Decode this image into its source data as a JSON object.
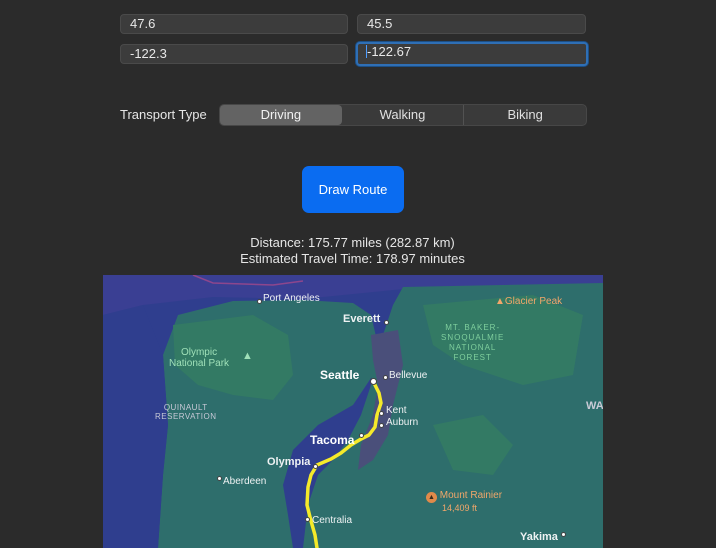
{
  "coordinates": {
    "lat1": "47.6",
    "lat2": "45.5",
    "lon1": "-122.3",
    "lon2": "-122.67"
  },
  "transport": {
    "label": "Transport Type",
    "options": [
      "Driving",
      "Walking",
      "Biking"
    ],
    "selected": "Driving"
  },
  "draw_button": "Draw Route",
  "result": {
    "distance": "Distance: 175.77 miles (282.87 km)",
    "travel_time": "Estimated Travel Time: 178.97 minutes"
  },
  "map": {
    "cities": {
      "port_angeles": "Port Angeles",
      "everett": "Everett",
      "seattle": "Seattle",
      "bellevue": "Bellevue",
      "kent": "Kent",
      "auburn": "Auburn",
      "tacoma": "Tacoma",
      "olympia": "Olympia",
      "aberdeen": "Aberdeen",
      "centralia": "Centralia",
      "yakima": "Yakima",
      "wa": "WA"
    },
    "parks": {
      "olympic_line1": "Olympic",
      "olympic_line2": "National Park",
      "forest_line1": "MT. BAKER-",
      "forest_line2": "SNOQUALMIE",
      "forest_line3": "NATIONAL",
      "forest_line4": "FOREST",
      "reservation_line1": "QUINAULT",
      "reservation_line2": "RESERVATION"
    },
    "pois": {
      "glacier_peak": "Glacier Peak",
      "mount_rainier": "Mount Rainier",
      "mount_rainier_elev": "14,409 ft"
    },
    "colors": {
      "water": "#2f3e8e",
      "land": "#2e6e6c",
      "forest": "#337a64",
      "urban": "#4a4f7a",
      "route": "#f5ea2a"
    }
  }
}
